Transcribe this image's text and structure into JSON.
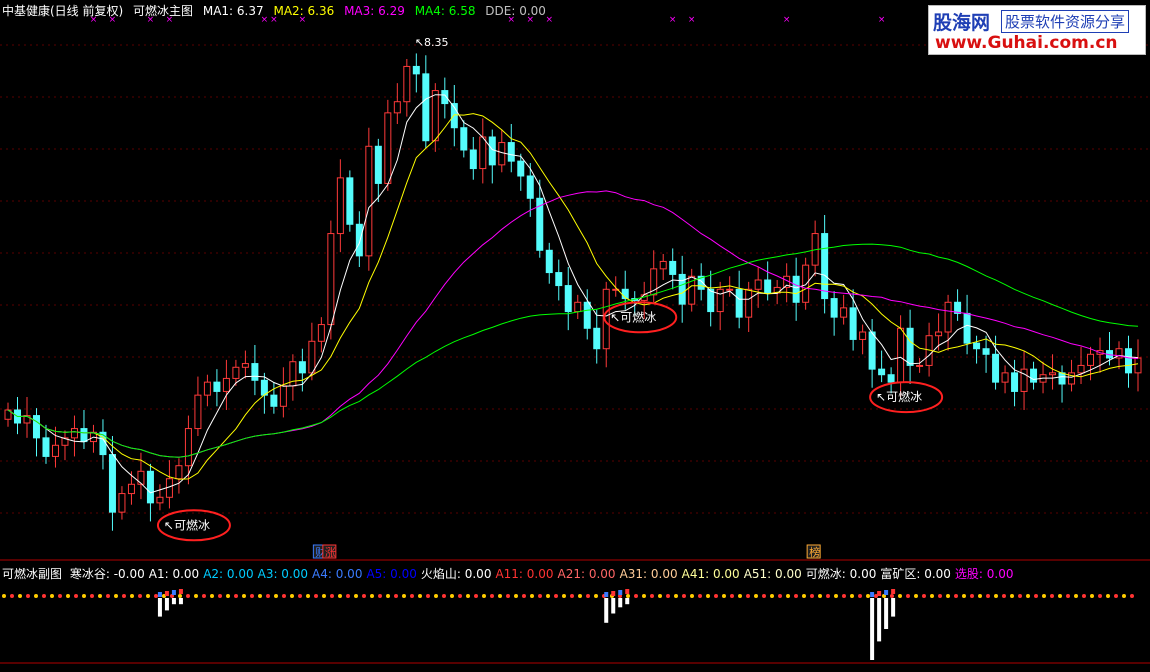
{
  "header": {
    "title": "中基健康(日线 前复权)",
    "indicator": "可燃冰主图",
    "legend": [
      {
        "label": "MA1: 6.37",
        "color": "#ffffff"
      },
      {
        "label": "MA2: 6.36",
        "color": "#ffff00"
      },
      {
        "label": "MA3: 6.29",
        "color": "#ff00ff"
      },
      {
        "label": "MA4: 6.58",
        "color": "#00ff00"
      },
      {
        "label": "DDE: 0.00",
        "color": "#c0c0c0"
      }
    ]
  },
  "logo": {
    "name": "股海网",
    "slogan": "股票软件资源分享",
    "url": "www.Guhai.com.cn"
  },
  "main_chart": {
    "high_label": "8.35",
    "annotations": [
      {
        "text": "可燃冰",
        "index": 16
      },
      {
        "text": "可燃冰",
        "index": 63
      },
      {
        "text": "可燃冰",
        "index": 91
      }
    ],
    "tags": [
      {
        "text": "财",
        "color": "#3a7bff",
        "index": 33
      },
      {
        "text": "涨",
        "color": "#ff3333",
        "index": 34
      },
      {
        "text": "榜",
        "color": "#ffaa33",
        "index": 85
      }
    ]
  },
  "sub_chart": {
    "title": "可燃冰副图",
    "legend": [
      {
        "label": "寒冰谷: -0.00",
        "color": "#ffffff"
      },
      {
        "label": "A1: 0.00",
        "color": "#ffffff"
      },
      {
        "label": "A2: 0.00",
        "color": "#00ccff"
      },
      {
        "label": "A3: 0.00",
        "color": "#00ccff"
      },
      {
        "label": "A4: 0.00",
        "color": "#3a7bff"
      },
      {
        "label": "A5: 0.00",
        "color": "#0000ff"
      },
      {
        "label": "火焰山: 0.00",
        "color": "#ffffff"
      },
      {
        "label": "A11: 0.00",
        "color": "#ff3333"
      },
      {
        "label": "A21: 0.00",
        "color": "#ff6666"
      },
      {
        "label": "A31: 0.00",
        "color": "#ffcc99"
      },
      {
        "label": "A41: 0.00",
        "color": "#ffff99"
      },
      {
        "label": "A51: 0.00",
        "color": "#ffffcc"
      },
      {
        "label": "可燃冰: 0.00",
        "color": "#ffffff"
      },
      {
        "label": "富矿区: 0.00",
        "color": "#ffffff"
      },
      {
        "label": "选股: 0.00",
        "color": "#ff00ff"
      }
    ]
  },
  "chart_data": {
    "type": "candlestick",
    "close": [
      6.4,
      6.33,
      6.37,
      6.25,
      6.15,
      6.21,
      6.25,
      6.3,
      6.23,
      6.28,
      6.16,
      5.85,
      5.95,
      6.0,
      6.07,
      5.9,
      5.93,
      6.03,
      6.1,
      6.3,
      6.48,
      6.55,
      6.5,
      6.57,
      6.63,
      6.65,
      6.56,
      6.48,
      6.42,
      6.53,
      6.66,
      6.6,
      6.77,
      6.86,
      7.35,
      7.65,
      7.4,
      7.23,
      7.82,
      7.62,
      8.0,
      8.06,
      8.25,
      8.21,
      7.85,
      8.12,
      8.05,
      7.92,
      7.8,
      7.7,
      7.87,
      7.72,
      7.84,
      7.74,
      7.66,
      7.54,
      7.26,
      7.14,
      7.07,
      6.93,
      6.98,
      6.84,
      6.73,
      7.05,
      7.05,
      7.0,
      6.99,
      7.02,
      7.16,
      7.2,
      7.13,
      6.97,
      7.12,
      7.05,
      6.93,
      7.05,
      7.05,
      6.9,
      7.05,
      7.1,
      7.03,
      7.06,
      7.12,
      6.98,
      7.18,
      7.35,
      7.0,
      6.9,
      6.95,
      6.78,
      6.82,
      6.62,
      6.59,
      6.55,
      6.84,
      6.64,
      6.64,
      6.8,
      6.82,
      6.98,
      6.92,
      6.76,
      6.73,
      6.7,
      6.55,
      6.6,
      6.5,
      6.62,
      6.55,
      6.59,
      6.6,
      6.54,
      6.6,
      6.64,
      6.7,
      6.72,
      6.68,
      6.73,
      6.6,
      6.68
    ],
    "ma_lines": [
      "MA1",
      "MA2",
      "MA3",
      "MA4"
    ],
    "ylim": [
      5.7,
      8.5
    ],
    "sub_chart_spikes": [
      {
        "index": 16,
        "values": [
          0.3,
          0.2,
          0.1,
          0.1
        ]
      },
      {
        "index": 63,
        "values": [
          0.4,
          0.25,
          0.15,
          0.1
        ]
      },
      {
        "index": 91,
        "values": [
          1.0,
          0.7,
          0.5,
          0.3
        ]
      }
    ]
  }
}
